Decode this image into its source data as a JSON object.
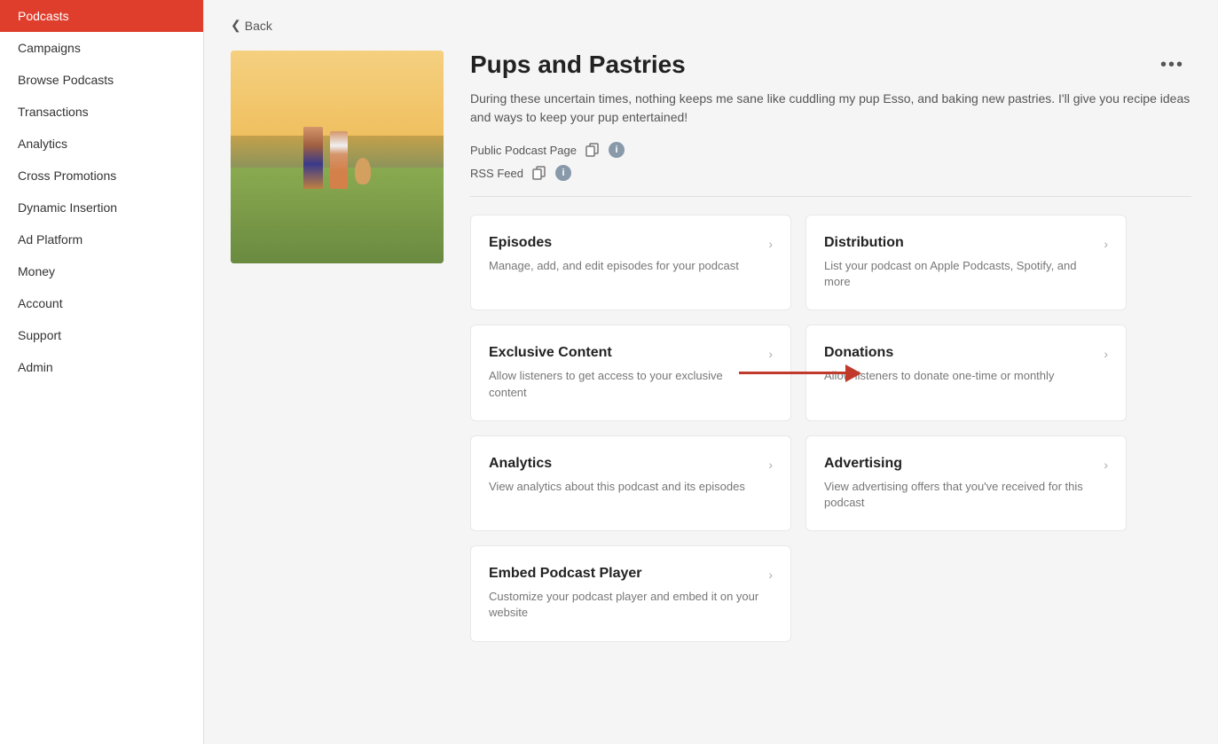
{
  "sidebar": {
    "items": [
      {
        "label": "Podcasts",
        "active": true
      },
      {
        "label": "Campaigns",
        "active": false
      },
      {
        "label": "Browse Podcasts",
        "active": false
      },
      {
        "label": "Transactions",
        "active": false
      },
      {
        "label": "Analytics",
        "active": false
      },
      {
        "label": "Cross Promotions",
        "active": false
      },
      {
        "label": "Dynamic Insertion",
        "active": false
      },
      {
        "label": "Ad Platform",
        "active": false
      },
      {
        "label": "Money",
        "active": false
      },
      {
        "label": "Account",
        "active": false
      },
      {
        "label": "Support",
        "active": false
      },
      {
        "label": "Admin",
        "active": false
      }
    ]
  },
  "back": "Back",
  "podcast": {
    "title": "Pups and Pastries",
    "description": "During these uncertain times, nothing keeps me sane like cuddling my pup Esso, and baking new pastries. I'll give you recipe ideas and ways to keep your pup entertained!",
    "public_page_label": "Public Podcast Page",
    "rss_feed_label": "RSS Feed"
  },
  "cards": [
    {
      "id": "episodes",
      "title": "Episodes",
      "description": "Manage, add, and edit episodes for your podcast"
    },
    {
      "id": "distribution",
      "title": "Distribution",
      "description": "List your podcast on Apple Podcasts, Spotify, and more"
    },
    {
      "id": "exclusive-content",
      "title": "Exclusive Content",
      "description": "Allow listeners to get access to your exclusive content"
    },
    {
      "id": "donations",
      "title": "Donations",
      "description": "Allow listeners to donate one-time or monthly"
    },
    {
      "id": "analytics",
      "title": "Analytics",
      "description": "View analytics about this podcast and its episodes"
    },
    {
      "id": "advertising",
      "title": "Advertising",
      "description": "View advertising offers that you've received for this podcast"
    },
    {
      "id": "embed",
      "title": "Embed Podcast Player",
      "description": "Customize your podcast player and embed it on your website"
    }
  ]
}
